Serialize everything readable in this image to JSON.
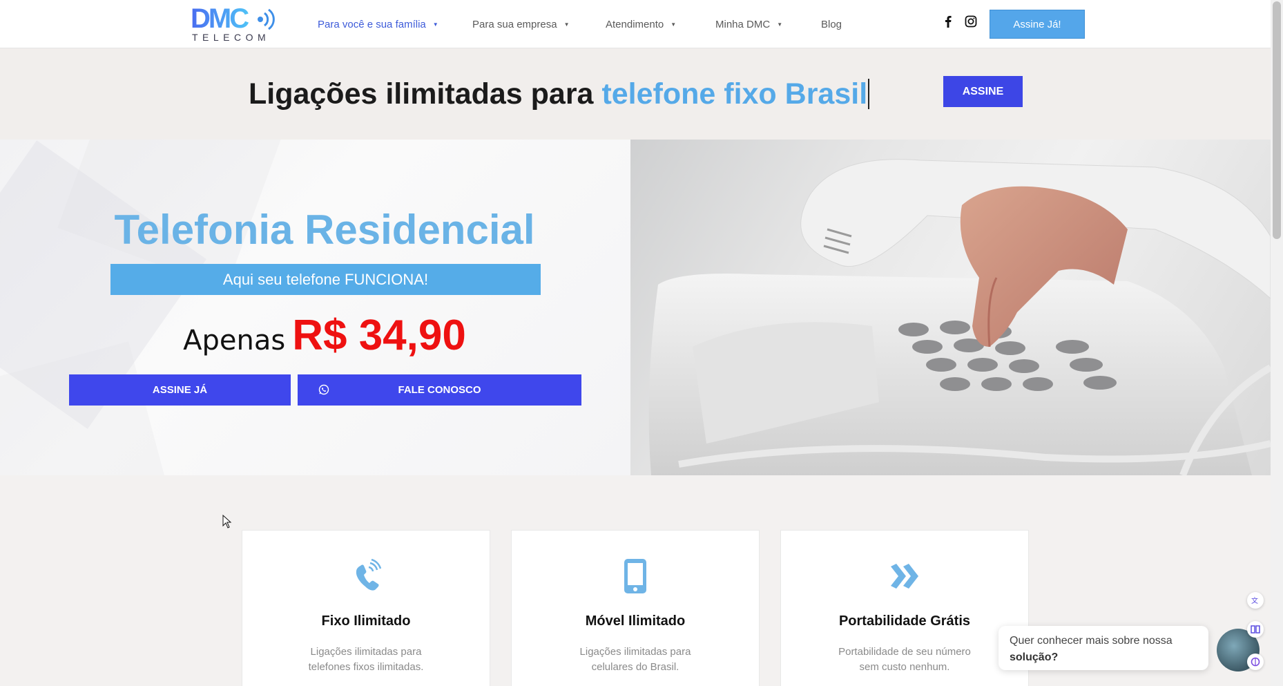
{
  "header": {
    "logo_sub": "TELECOM",
    "nav": [
      {
        "label": "Para você e sua família",
        "active": true
      },
      {
        "label": "Para sua empresa",
        "active": false
      },
      {
        "label": "Atendimento",
        "active": false
      },
      {
        "label": "Minha DMC",
        "active": false
      },
      {
        "label": "Blog",
        "active": false
      }
    ],
    "cta": "Assine Já!"
  },
  "banner": {
    "text_prefix": "Ligações ilimitadas para ",
    "text_highlight": "telefone fixo Brasil",
    "button": "ASSINE"
  },
  "hero": {
    "title": "Telefonia Residencial",
    "tagline": "Aqui seu telefone FUNCIONA!",
    "price_prefix": "Apenas",
    "price": "R$ 34,90",
    "btn_subscribe": "ASSINE JÁ",
    "btn_contact": "FALE CONOSCO"
  },
  "cards": [
    {
      "title": "Fixo Ilimitado",
      "desc": "Ligações ilimitadas para telefones fixos ilimitadas.",
      "icon": "phone-ringing-icon"
    },
    {
      "title": "Móvel Ilimitado",
      "desc": "Ligações ilimitadas para celulares do Brasil.",
      "icon": "smartphone-icon"
    },
    {
      "title": "Portabilidade Grátis",
      "desc": "Portabilidade de seu número sem custo nenhum.",
      "icon": "double-chevron-icon"
    }
  ],
  "chat": {
    "text": "Quer conhecer mais sobre nossa",
    "text_bold": "solução?"
  },
  "colors": {
    "accent_blue": "#55a9e8",
    "button_blue": "#3d46e6",
    "price_red": "#ee1111"
  }
}
